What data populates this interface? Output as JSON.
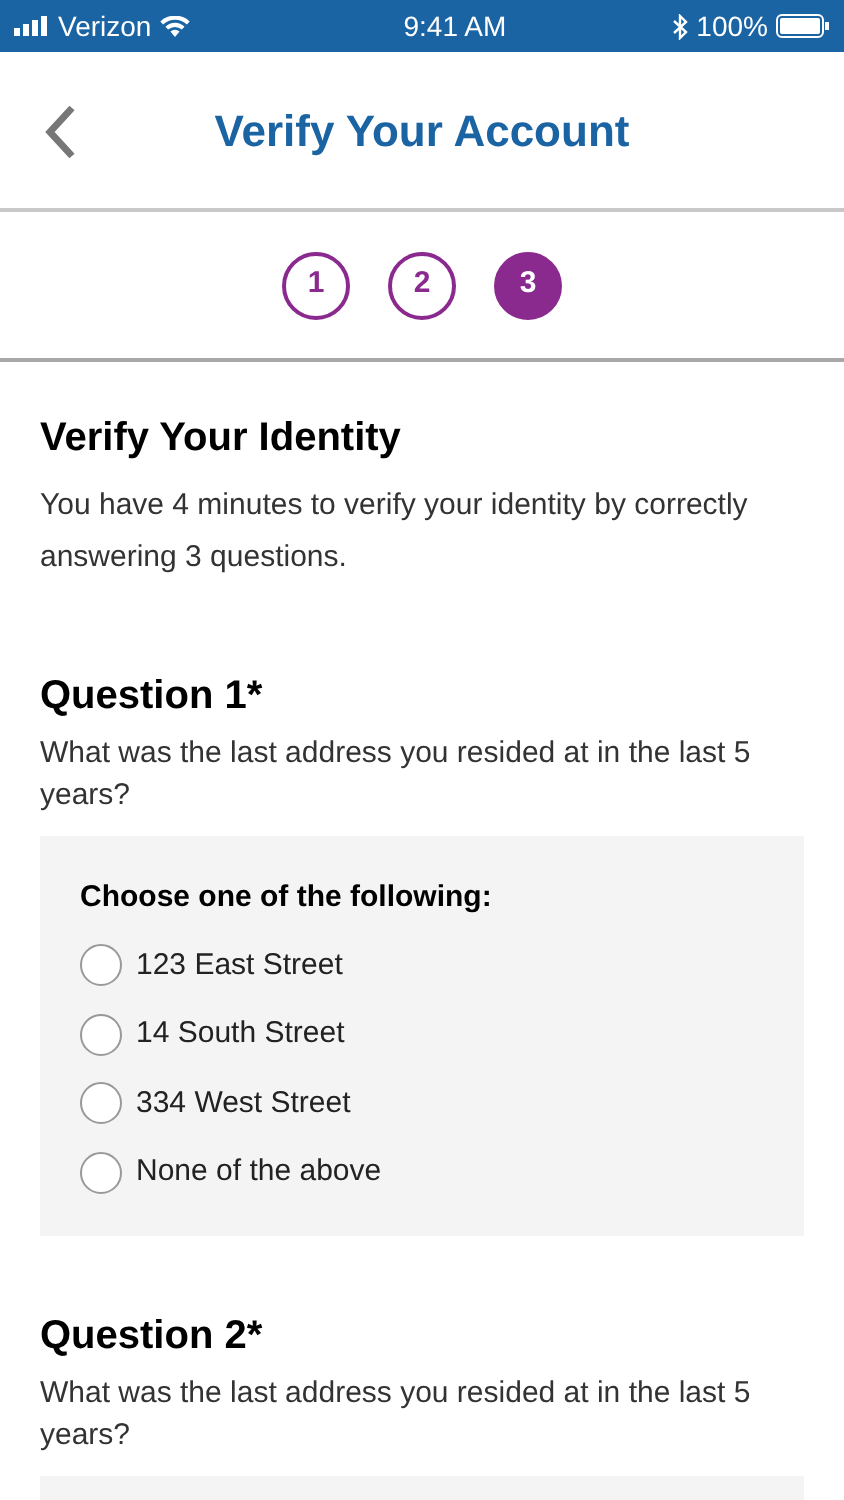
{
  "status_bar": {
    "carrier": "Verizon",
    "time": "9:41 AM",
    "battery": "100%"
  },
  "header": {
    "title": "Verify Your Account"
  },
  "steps": [
    {
      "label": "1",
      "selected": false
    },
    {
      "label": "2",
      "selected": false
    },
    {
      "label": "3",
      "selected": true
    }
  ],
  "intro": {
    "heading": "Verify Your Identity",
    "text": "You have 4 minutes to verify your identity by correctly answering 3 questions."
  },
  "questions": [
    {
      "title": "Question 1*",
      "prompt": "What was the last address you resided at in the last 5 years?",
      "choose_label": "Choose one of the following:",
      "options": [
        {
          "label": "123 East Street",
          "selected": false
        },
        {
          "label": "14 South Street",
          "selected": false
        },
        {
          "label": "334 West Street",
          "selected": false
        },
        {
          "label": "None of the above",
          "selected": false
        }
      ]
    },
    {
      "title": "Question 2*",
      "prompt": "What was the last address you resided at in the last 5 years?"
    }
  ]
}
